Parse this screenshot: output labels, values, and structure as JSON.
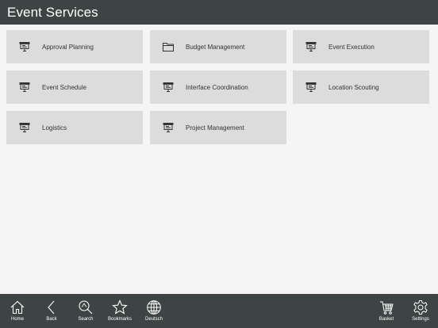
{
  "header": {
    "title": "Event Services"
  },
  "tiles": [
    {
      "label": "Approval Planning",
      "icon": "presentation-board-icon"
    },
    {
      "label": "Budget Management",
      "icon": "folder-icon"
    },
    {
      "label": "Event Execution",
      "icon": "presentation-board-icon"
    },
    {
      "label": "Event Schedule",
      "icon": "presentation-board-icon"
    },
    {
      "label": "Interface Coordination",
      "icon": "presentation-board-icon"
    },
    {
      "label": "Location Scouting",
      "icon": "presentation-board-icon"
    },
    {
      "label": "Logistics",
      "icon": "presentation-board-icon"
    },
    {
      "label": "Project Management",
      "icon": "presentation-board-icon"
    }
  ],
  "toolbar": {
    "home": "Home",
    "back": "Back",
    "search": "Search",
    "bookmarks": "Bookmarks",
    "language": "Deutsch",
    "basket": "Basket",
    "settings": "Settings"
  },
  "colors": {
    "bar": "#3d4544",
    "tile": "#dcdcdc",
    "background": "#f5f5f5"
  }
}
